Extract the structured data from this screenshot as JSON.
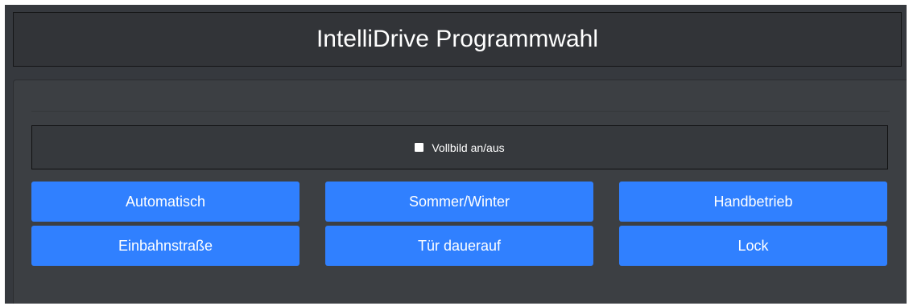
{
  "header": {
    "title": "IntelliDrive Programmwahl"
  },
  "fullscreen": {
    "label": "Vollbild an/aus",
    "checked": false
  },
  "buttons": [
    {
      "label": "Automatisch"
    },
    {
      "label": "Sommer/Winter"
    },
    {
      "label": "Handbetrieb"
    },
    {
      "label": "Einbahnstraße"
    },
    {
      "label": "Tür dauerauf"
    },
    {
      "label": "Lock"
    }
  ],
  "colors": {
    "background": "#36393e",
    "button": "#3080ff",
    "text": "#ffffff"
  }
}
